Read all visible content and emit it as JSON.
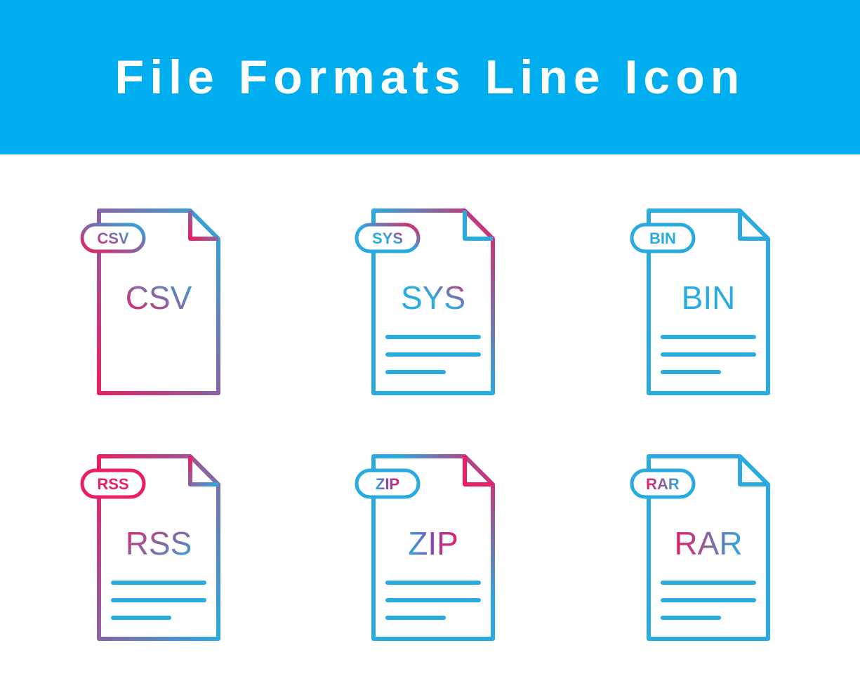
{
  "banner": {
    "title": "File Formats Line Icon"
  },
  "icons": [
    {
      "label": "CSV",
      "badge": "CSV"
    },
    {
      "label": "SYS",
      "badge": "SYS"
    },
    {
      "label": "BIN",
      "badge": "BIN"
    },
    {
      "label": "RSS",
      "badge": "RSS"
    },
    {
      "label": "ZIP",
      "badge": "ZIP"
    },
    {
      "label": "RAR",
      "badge": "RAR"
    }
  ],
  "colors": {
    "banner": "#00aeef",
    "gradient_start": "#e91e63",
    "gradient_end": "#29abe2"
  }
}
